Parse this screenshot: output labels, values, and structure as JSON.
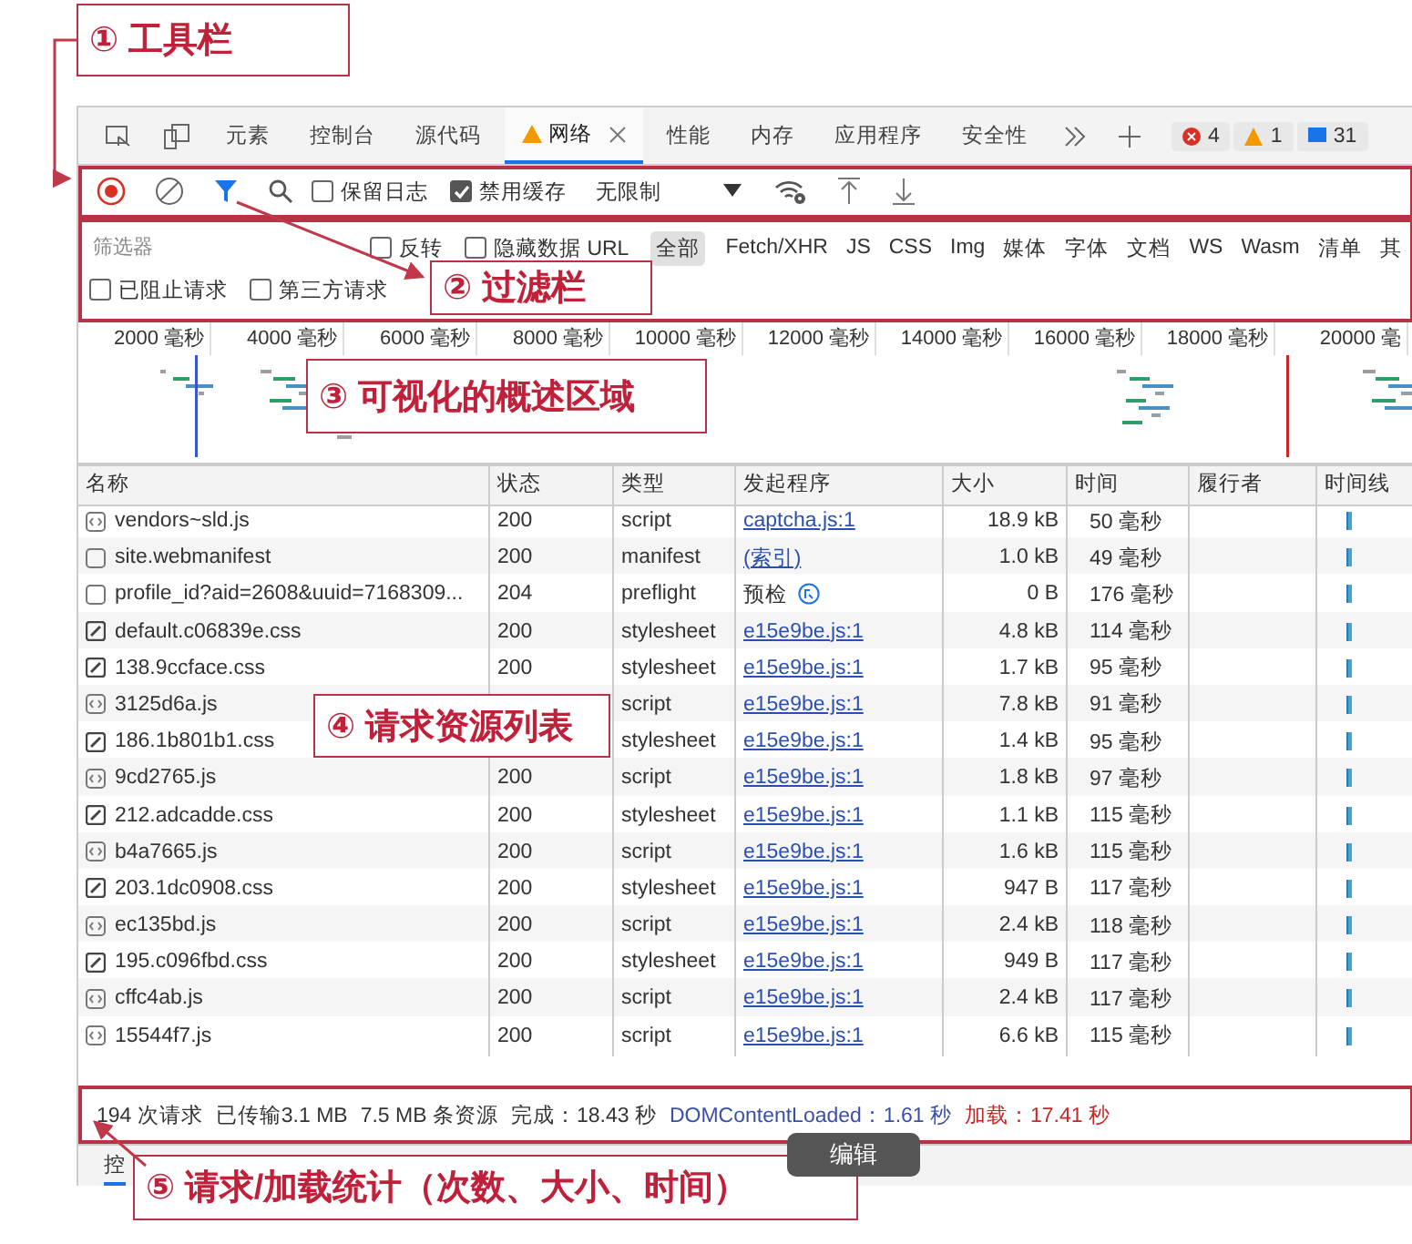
{
  "annotations": [
    {
      "text": "① 工具栏"
    },
    {
      "text": "② 过滤栏"
    },
    {
      "text": "③ 可视化的概述区域"
    },
    {
      "text": "④ 请求资源列表"
    },
    {
      "text": "⑤ 请求/加载统计（次数、大小、时间）"
    }
  ],
  "tabs": [
    {
      "label": "元素",
      "selected": false,
      "warning": false
    },
    {
      "label": "控制台",
      "selected": false,
      "warning": false
    },
    {
      "label": "源代码",
      "selected": false,
      "warning": false
    },
    {
      "label": "网络",
      "selected": true,
      "warning": true
    },
    {
      "label": "性能",
      "selected": false,
      "warning": false
    },
    {
      "label": "内存",
      "selected": false,
      "warning": false
    },
    {
      "label": "应用程序",
      "selected": false,
      "warning": false
    },
    {
      "label": "安全性",
      "selected": false,
      "warning": false
    }
  ],
  "badges": [
    {
      "kind": "error",
      "count": "4"
    },
    {
      "kind": "warning",
      "count": "1"
    },
    {
      "kind": "message",
      "count": "31"
    }
  ],
  "toolbar": {
    "recording": true,
    "checkboxes": [
      {
        "label": "保留日志",
        "checked": false
      },
      {
        "label": "禁用缓存",
        "checked": true
      }
    ],
    "throttling": "无限制"
  },
  "filter": {
    "placeholder": "筛选器",
    "options": [
      {
        "label": "反转",
        "checked": false
      },
      {
        "label": "隐藏数据 URL",
        "checked": false
      }
    ],
    "types": [
      {
        "label": "全部",
        "selected": true
      },
      {
        "label": "Fetch/XHR",
        "selected": false
      },
      {
        "label": "JS",
        "selected": false
      },
      {
        "label": "CSS",
        "selected": false
      },
      {
        "label": "Img",
        "selected": false
      },
      {
        "label": "媒体",
        "selected": false
      },
      {
        "label": "字体",
        "selected": false
      },
      {
        "label": "文档",
        "selected": false
      },
      {
        "label": "WS",
        "selected": false
      },
      {
        "label": "Wasm",
        "selected": false
      },
      {
        "label": "清单",
        "selected": false
      },
      {
        "label": "其",
        "selected": false
      }
    ],
    "extra": [
      {
        "label": "已阻止请求",
        "checked": false
      },
      {
        "label": "第三方请求",
        "checked": false
      }
    ]
  },
  "overview": {
    "ticks": [
      "2000 毫秒",
      "4000 毫秒",
      "6000 毫秒",
      "8000 毫秒",
      "10000 毫秒",
      "12000 毫秒",
      "14000 毫秒",
      "16000 毫秒",
      "18000 毫秒",
      "20000 毫"
    ]
  },
  "table": {
    "columns": [
      "名称",
      "状态",
      "类型",
      "发起程序",
      "大小",
      "时间",
      "履行者",
      "时间线"
    ],
    "rows": [
      {
        "name": "vendors~sld.js",
        "kind": "script",
        "status": "200",
        "type": "script",
        "initiator": {
          "text": "captcha.js:1",
          "kind": "link"
        },
        "size": "18.9 kB",
        "time": "50 毫秒"
      },
      {
        "name": "site.webmanifest",
        "kind": "document",
        "status": "200",
        "type": "manifest",
        "initiator": {
          "text": "(索引)",
          "kind": "link"
        },
        "size": "1.0 kB",
        "time": "49 毫秒"
      },
      {
        "name": "profile_id?aid=2608&uuid=7168309...",
        "kind": "document",
        "status": "204",
        "type": "preflight",
        "initiator": {
          "text": "预检",
          "kind": "preflight"
        },
        "size": "0 B",
        "time": "176 毫秒"
      },
      {
        "name": "default.c06839e.css",
        "kind": "stylesheet",
        "status": "200",
        "type": "stylesheet",
        "initiator": {
          "text": "e15e9be.js:1",
          "kind": "link"
        },
        "size": "4.8 kB",
        "time": "114 毫秒"
      },
      {
        "name": "138.9ccface.css",
        "kind": "stylesheet",
        "status": "200",
        "type": "stylesheet",
        "initiator": {
          "text": "e15e9be.js:1",
          "kind": "link"
        },
        "size": "1.7 kB",
        "time": "95 毫秒"
      },
      {
        "name": "3125d6a.js",
        "kind": "script",
        "type": "script",
        "initiator": {
          "text": "e15e9be.js:1",
          "kind": "link"
        },
        "size": "7.8 kB",
        "time": "91 毫秒"
      },
      {
        "name": "186.1b801b1.css",
        "kind": "stylesheet",
        "type": "stylesheet",
        "initiator": {
          "text": "e15e9be.js:1",
          "kind": "link"
        },
        "size": "1.4 kB",
        "time": "95 毫秒"
      },
      {
        "name": "9cd2765.js",
        "kind": "script",
        "status": "200",
        "type": "script",
        "initiator": {
          "text": "e15e9be.js:1",
          "kind": "link"
        },
        "size": "1.8 kB",
        "time": "97 毫秒"
      },
      {
        "name": "212.adcadde.css",
        "kind": "stylesheet",
        "status": "200",
        "type": "stylesheet",
        "initiator": {
          "text": "e15e9be.js:1",
          "kind": "link"
        },
        "size": "1.1 kB",
        "time": "115 毫秒"
      },
      {
        "name": "b4a7665.js",
        "kind": "script",
        "status": "200",
        "type": "script",
        "initiator": {
          "text": "e15e9be.js:1",
          "kind": "link"
        },
        "size": "1.6 kB",
        "time": "115 毫秒"
      },
      {
        "name": "203.1dc0908.css",
        "kind": "stylesheet",
        "status": "200",
        "type": "stylesheet",
        "initiator": {
          "text": "e15e9be.js:1",
          "kind": "link"
        },
        "size": "947 B",
        "time": "117 毫秒"
      },
      {
        "name": "ec135bd.js",
        "kind": "script",
        "status": "200",
        "type": "script",
        "initiator": {
          "text": "e15e9be.js:1",
          "kind": "link"
        },
        "size": "2.4 kB",
        "time": "118 毫秒"
      },
      {
        "name": "195.c096fbd.css",
        "kind": "stylesheet",
        "status": "200",
        "type": "stylesheet",
        "initiator": {
          "text": "e15e9be.js:1",
          "kind": "link"
        },
        "size": "949 B",
        "time": "117 毫秒"
      },
      {
        "name": "cffc4ab.js",
        "kind": "script",
        "status": "200",
        "type": "script",
        "initiator": {
          "text": "e15e9be.js:1",
          "kind": "link"
        },
        "size": "2.4 kB",
        "time": "117 毫秒"
      },
      {
        "name": "15544f7.js",
        "kind": "script",
        "status": "200",
        "type": "script",
        "initiator": {
          "text": "e15e9be.js:1",
          "kind": "link"
        },
        "size": "6.6 kB",
        "time": "115 毫秒"
      }
    ]
  },
  "status_bar": [
    {
      "text": "194 次请求",
      "kind": "plain"
    },
    {
      "text": "已传输3.1 MB",
      "kind": "plain"
    },
    {
      "text": "7.5 MB 条资源",
      "kind": "plain"
    },
    {
      "text": "完成：18.43 秒",
      "kind": "plain"
    },
    {
      "text": "DOMContentLoaded：1.61 秒",
      "kind": "dom"
    },
    {
      "text": "加载：17.41 秒",
      "kind": "load"
    }
  ],
  "drawer": {
    "tab": "控"
  },
  "edit_button": "编辑"
}
